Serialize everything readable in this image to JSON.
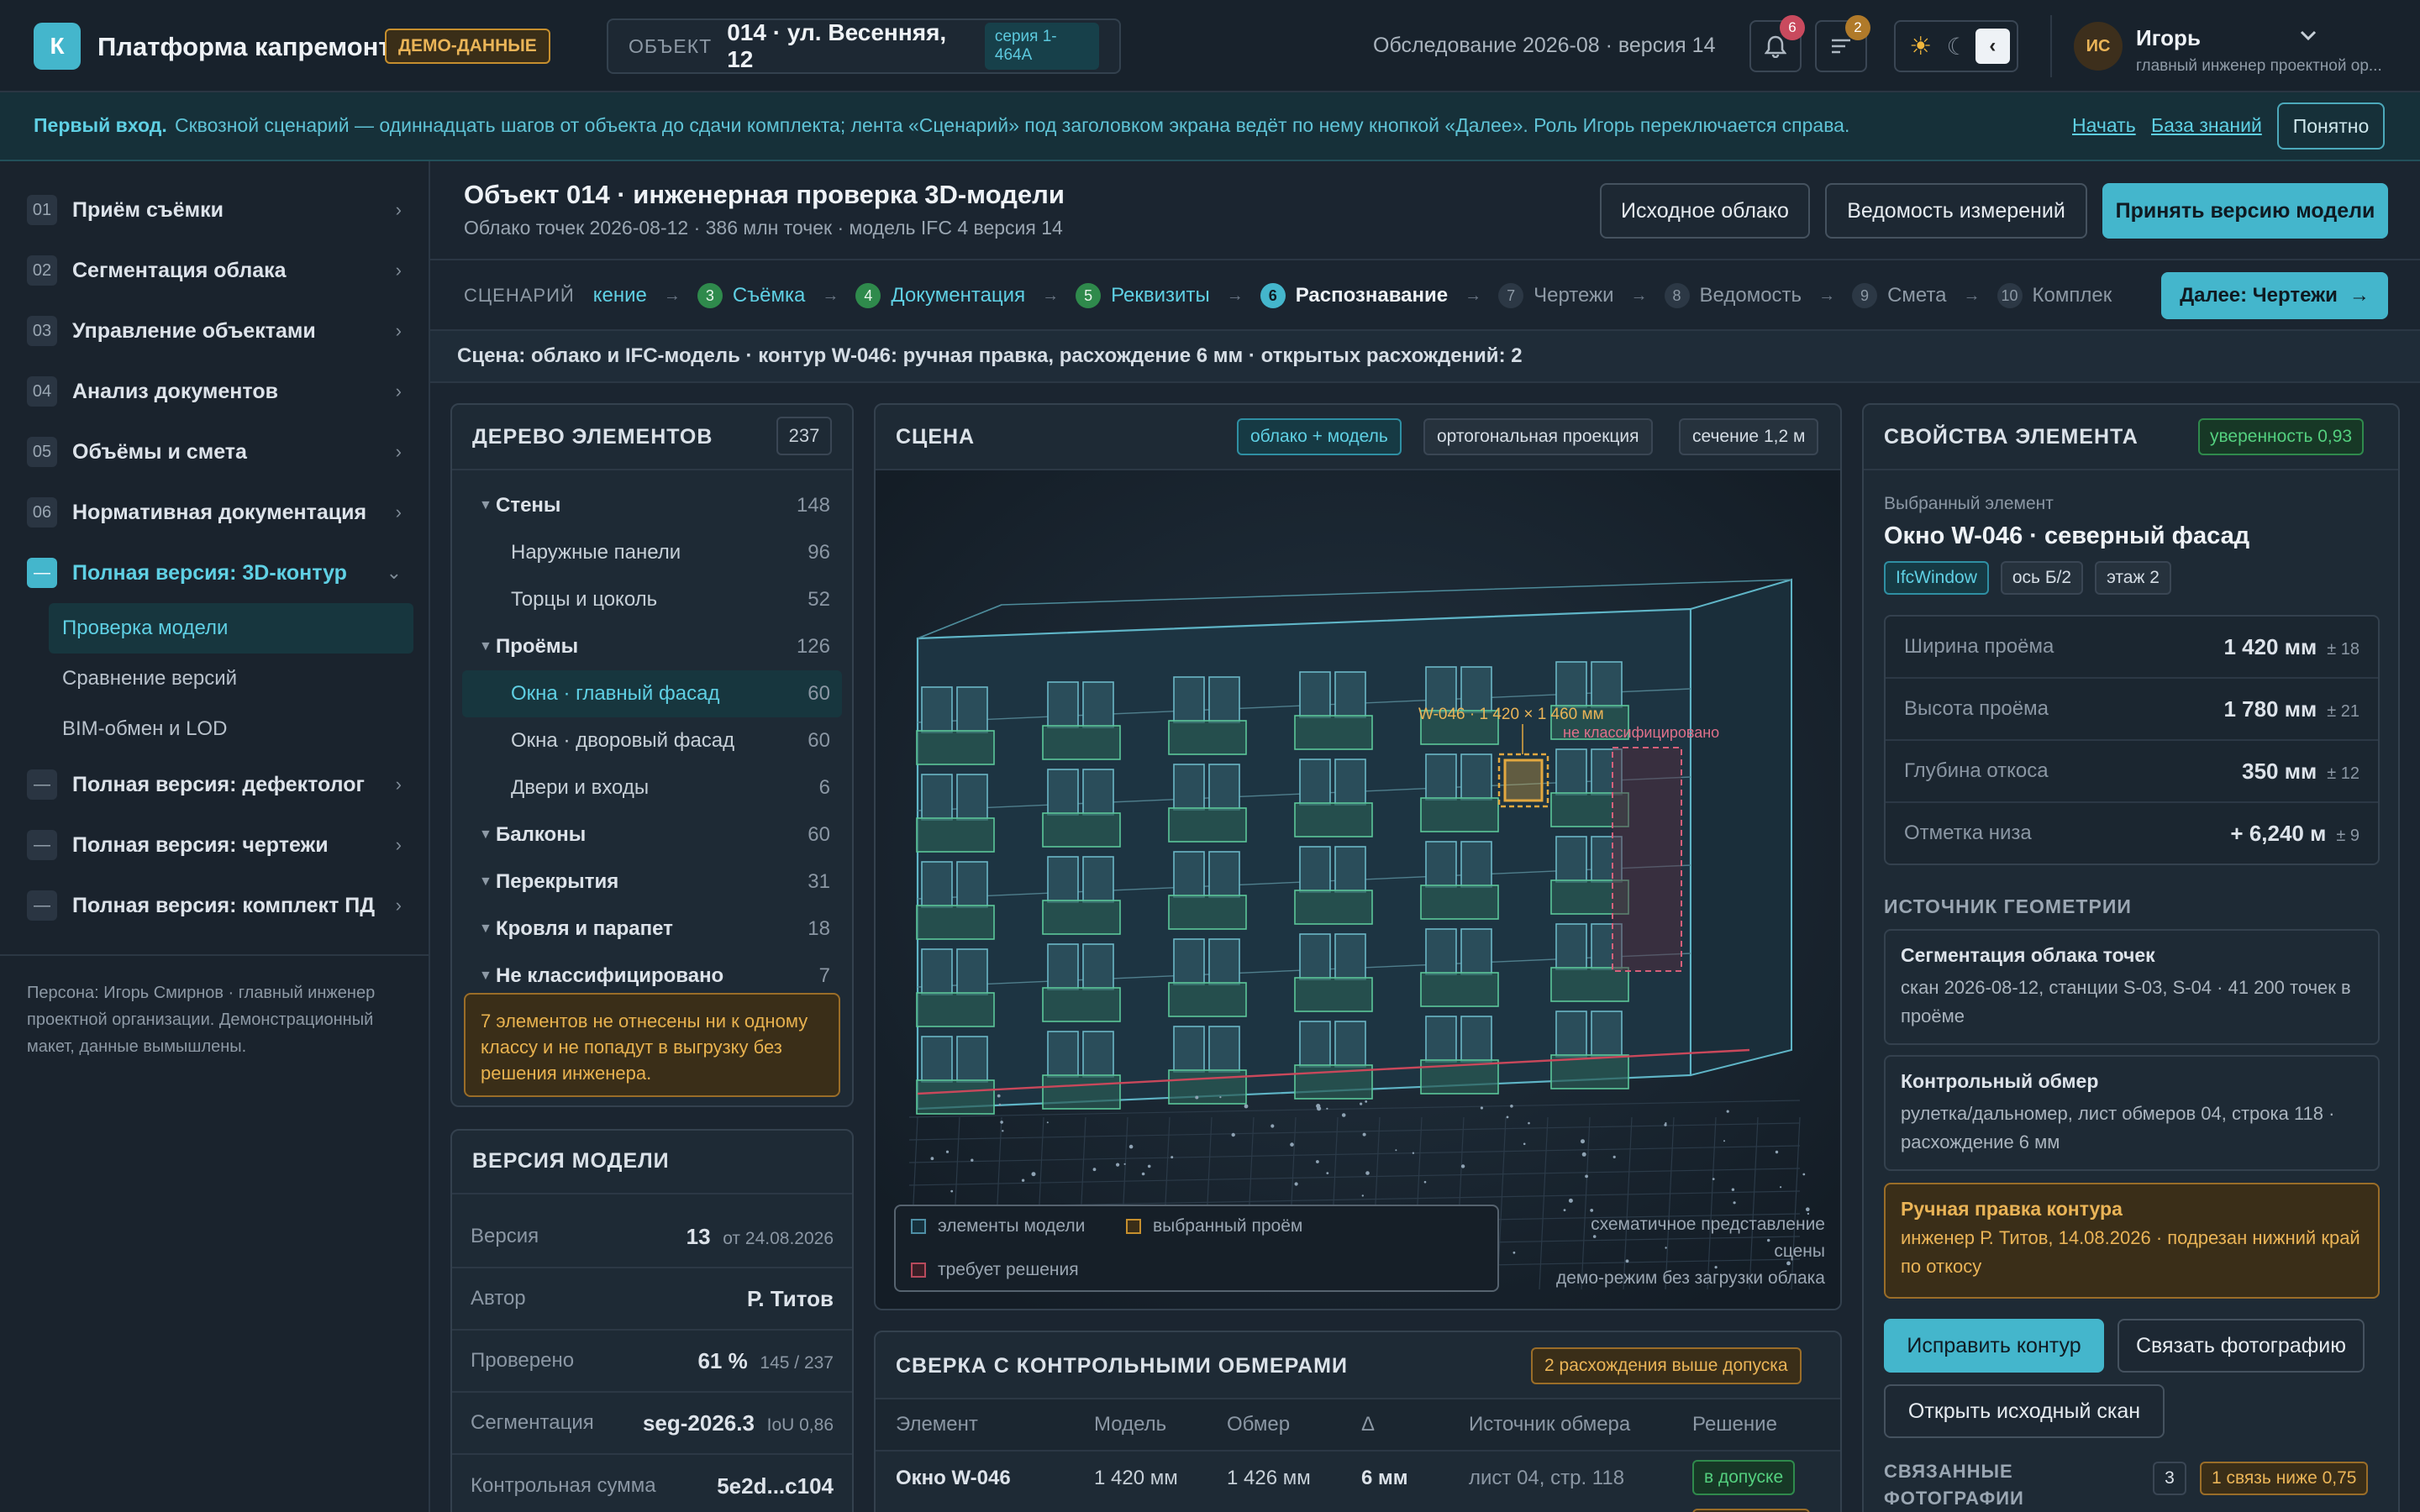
{
  "app": {
    "logo_letter": "К",
    "title": "Платформа капремонта",
    "demo_badge": "ДЕМО-ДАННЫЕ"
  },
  "object_selector": {
    "label": "ОБЪЕКТ",
    "value": "014 · ул. Весенняя, 12",
    "series": "серия 1-464А"
  },
  "survey": "Обследование 2026-08 · версия 14",
  "notifications": {
    "bell_count": "6",
    "tasks_count": "2"
  },
  "theme": {
    "sun": "☀",
    "moon": "☾",
    "toggle": "‹"
  },
  "user": {
    "initials": "ИС",
    "name": "Игорь",
    "role": "главный инженер проектной ор..."
  },
  "banner": {
    "lead": "Первый вход.",
    "text": "Сквозной сценарий — одиннадцать шагов от объекта до сдачи комплекта; лента «Сценарий» под заголовком экрана ведёт по нему кнопкой «Далее». Роль Игорь переключается справа.",
    "start": "Начать",
    "kb": "База знаний",
    "ok": "Понятно"
  },
  "sidebar": {
    "items": [
      {
        "num": "01",
        "label": "Приём съёмки"
      },
      {
        "num": "02",
        "label": "Сегментация облака"
      },
      {
        "num": "03",
        "label": "Управление объектами"
      },
      {
        "num": "04",
        "label": "Анализ документов"
      },
      {
        "num": "05",
        "label": "Объёмы и смета"
      },
      {
        "num": "06",
        "label": "Нормативная документация"
      },
      {
        "num": "—",
        "label": "Полная версия: 3D-контур"
      },
      {
        "num": "—",
        "label": "Полная версия: дефектолог"
      },
      {
        "num": "—",
        "label": "Полная версия: чертежи"
      },
      {
        "num": "—",
        "label": "Полная версия: комплект ПД"
      }
    ],
    "sub": [
      "Проверка модели",
      "Сравнение версий",
      "BIM-обмен и LOD"
    ],
    "footer": "Персона: Игорь Смирнов · главный инженер проектной организации. Демонстрационный макет, данные вымышлены."
  },
  "header": {
    "title": "Объект 014 · инженерная проверка 3D-модели",
    "subtitle": "Облако точек 2026-08-12 · 386 млн точек · модель IFC 4 версия 14",
    "btn_cloud": "Исходное облако",
    "btn_measure": "Ведомость измерений",
    "btn_accept": "Принять версию модели"
  },
  "scenario": {
    "label": "СЦЕНАРИЙ",
    "partial": "кение",
    "steps": [
      {
        "n": "3",
        "label": "Съёмка"
      },
      {
        "n": "4",
        "label": "Документация"
      },
      {
        "n": "5",
        "label": "Реквизиты"
      },
      {
        "n": "6",
        "label": "Распознавание"
      },
      {
        "n": "7",
        "label": "Чертежи"
      },
      {
        "n": "8",
        "label": "Ведомость"
      },
      {
        "n": "9",
        "label": "Смета"
      },
      {
        "n": "10",
        "label": "Комплек"
      }
    ],
    "next": "Далее: Чертежи",
    "next_arrow": "→",
    "sep": "→"
  },
  "status_line": "Сцена: облако и IFC-модель · контур W-046: ручная правка, расхождение 6 мм · открытых расхождений: 2",
  "tree": {
    "title": "ДЕРЕВО ЭЛЕМЕНТОВ",
    "total": "237",
    "rows": [
      {
        "label": "Стены",
        "count": "148",
        "level": 0
      },
      {
        "label": "Наружные панели",
        "count": "96",
        "level": 1
      },
      {
        "label": "Торцы и цоколь",
        "count": "52",
        "level": 1
      },
      {
        "label": "Проёмы",
        "count": "126",
        "level": 0
      },
      {
        "label": "Окна · главный фасад",
        "count": "60",
        "level": 1,
        "active": true
      },
      {
        "label": "Окна · дворовый фасад",
        "count": "60",
        "level": 1
      },
      {
        "label": "Двери и входы",
        "count": "6",
        "level": 1
      },
      {
        "label": "Балконы",
        "count": "60",
        "level": 0
      },
      {
        "label": "Перекрытия",
        "count": "31",
        "level": 0
      },
      {
        "label": "Кровля и парапет",
        "count": "18",
        "level": 0
      },
      {
        "label": "Не классифицировано",
        "count": "7",
        "level": 0
      }
    ],
    "warning": "7 элементов не отнесены ни к одному классу и не попадут в выгрузку без решения инженера."
  },
  "version": {
    "title": "ВЕРСИЯ МОДЕЛИ",
    "rows": [
      {
        "k": "Версия",
        "v": "13",
        "sub": "от 24.08.2026"
      },
      {
        "k": "Автор",
        "v": "Р. Титов",
        "sub": ""
      },
      {
        "k": "Проверено",
        "v": "61 %",
        "sub": "145 / 237"
      },
      {
        "k": "Сегментация",
        "v": "seg-2026.3",
        "sub": "IoU 0,86"
      },
      {
        "k": "Контрольная сумма",
        "v": "5e2d...c104",
        "sub": ""
      }
    ]
  },
  "scene": {
    "title": "СЦЕНА",
    "chip_mode": "облако + модель",
    "chip_proj": "ортогональная проекция",
    "chip_section": "сечение 1,2 м",
    "annot_selected": "W-046 · 1 420 × 1 460 мм",
    "annot_unclassified": "не классифицировано",
    "legend": {
      "model": "элементы модели",
      "selected": "выбранный проём",
      "decision": "требует решения"
    },
    "note1": "схематичное представление",
    "note2": "сцены",
    "note3": "демо-режим без загрузки облака"
  },
  "reconcile": {
    "title": "СВЕРКА С КОНТРОЛЬНЫМИ ОБМЕРАМИ",
    "badge": "2 расхождения выше допуска",
    "cols": [
      "Элемент",
      "Модель",
      "Обмер",
      "Δ",
      "Источник обмера",
      "Решение"
    ],
    "rows": [
      {
        "el": "Окно W-046",
        "model": "1 420 мм",
        "meas": "1 426 мм",
        "delta": "6 мм",
        "src": "лист 04, стр. 118",
        "dec": "в допуске"
      }
    ]
  },
  "props": {
    "title": "СВОЙСТВА ЭЛЕМЕНТА",
    "confidence": "уверенность 0,93",
    "sel_label": "Выбранный элемент",
    "sel_name": "Окно W-046 · северный фасад",
    "tags": [
      "IfcWindow",
      "ось Б/2",
      "этаж 2"
    ],
    "metrics": [
      {
        "k": "Ширина проёма",
        "v": "1 420 мм",
        "tol": "± 18"
      },
      {
        "k": "Высота проёма",
        "v": "1 780 мм",
        "tol": "± 21"
      },
      {
        "k": "Глубина откоса",
        "v": "350 мм",
        "tol": "± 12"
      },
      {
        "k": "Отметка низа",
        "v": "+ 6,240 м",
        "tol": "± 9"
      }
    ],
    "geo_title": "ИСТОЧНИК ГЕОМЕТРИИ",
    "geo": [
      {
        "t": "Сегментация облака точек",
        "d": "скан 2026-08-12, станции S-03, S-04 · 41 200 точек в проёме"
      },
      {
        "t": "Контрольный обмер",
        "d": "рулетка/дальномер, лист обмеров 04, строка 118 · расхождение 6 мм"
      }
    ],
    "manual_t": "Ручная правка контура",
    "manual_d": "инженер Р. Титов, 14.08.2026 · подрезан нижний край по откосу",
    "btn_fix": "Исправить контур",
    "btn_photo": "Связать фотографию",
    "btn_scan": "Открыть исходный скан",
    "photos_title1": "СВЯЗАННЫЕ",
    "photos_title2": "ФОТОГРАФИИ",
    "photos_count": "3",
    "photos_badge": "1 связь ниже 0,75"
  },
  "colors": {
    "accent": "#44b6cc",
    "warning": "#e2a840",
    "ok": "#41b86a",
    "danger": "#c9485b"
  }
}
